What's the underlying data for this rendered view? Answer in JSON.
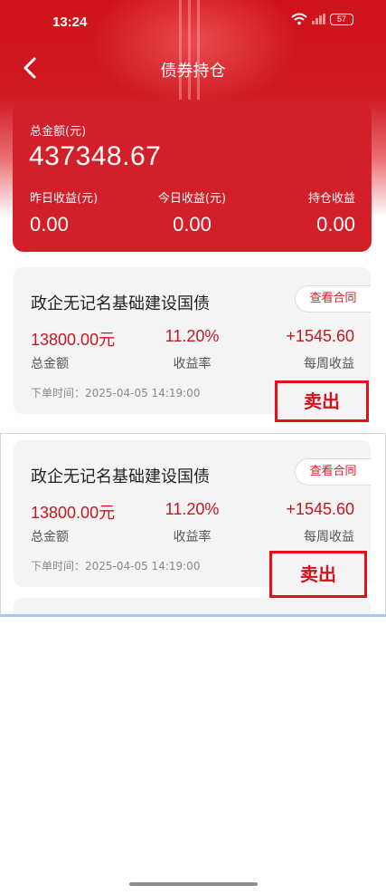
{
  "status_bar": {
    "time": "13:24",
    "battery": "57"
  },
  "nav": {
    "title": "债券持仓"
  },
  "summary": {
    "total_label": "总金额(元)",
    "total_value": "437348.67",
    "yesterday_label": "昨日收益(元)",
    "yesterday_value": "0.00",
    "today_label": "今日收益(元)",
    "today_value": "0.00",
    "holding_label": "持仓收益",
    "holding_value": "0.00"
  },
  "holdings": [
    {
      "name": "政企无记名基础建设国债",
      "contract_label": "查看合同",
      "amount": "13800.00元",
      "amount_label": "总金额",
      "rate": "11.20%",
      "rate_label": "收益率",
      "weekly": "+1545.60",
      "weekly_label": "每周收益",
      "order_time": "下单时间：2025-04-05 14:19:00",
      "sell_label": "卖出"
    },
    {
      "name": "政企无记名基础建设国债",
      "contract_label": "查看合同",
      "amount": "13800.00元",
      "amount_label": "总金额",
      "rate": "11.20%",
      "rate_label": "收益率",
      "weekly": "+1545.60",
      "weekly_label": "每周收益",
      "order_time": "下单时间：2025-04-05 14:19:00",
      "sell_label": "卖出"
    }
  ],
  "colors": {
    "brand_red": "#d21f2a",
    "sell_border": "#e0101c"
  }
}
